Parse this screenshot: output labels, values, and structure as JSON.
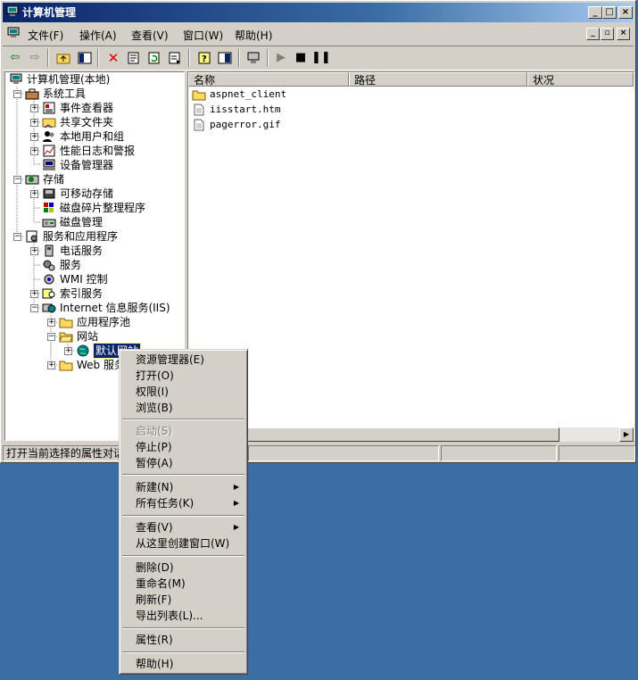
{
  "window": {
    "title": "计算机管理",
    "caption_buttons": [
      "_",
      "□",
      "×"
    ],
    "mdi_buttons": [
      "_",
      "▫",
      "×"
    ]
  },
  "menubar": {
    "items": [
      "文件(F)",
      "操作(A)",
      "查看(V)",
      "窗口(W)",
      "帮助(H)"
    ]
  },
  "tree": {
    "nodes": [
      {
        "label": "计算机管理(本地)"
      },
      {
        "label": "系统工具",
        "exp": "−"
      },
      {
        "label": "事件查看器",
        "exp": "+"
      },
      {
        "label": "共享文件夹",
        "exp": "+"
      },
      {
        "label": "本地用户和组",
        "exp": "+"
      },
      {
        "label": "性能日志和警报",
        "exp": "+"
      },
      {
        "label": "设备管理器"
      },
      {
        "label": "存储",
        "exp": "−"
      },
      {
        "label": "可移动存储",
        "exp": "+"
      },
      {
        "label": "磁盘碎片整理程序"
      },
      {
        "label": "磁盘管理"
      },
      {
        "label": "服务和应用程序",
        "exp": "−"
      },
      {
        "label": "电话服务",
        "exp": "+"
      },
      {
        "label": "服务"
      },
      {
        "label": "WMI 控制"
      },
      {
        "label": "索引服务",
        "exp": "+"
      },
      {
        "label": "Internet 信息服务(IIS)",
        "exp": "−"
      },
      {
        "label": "应用程序池",
        "exp": "+"
      },
      {
        "label": "网站",
        "exp": "−"
      },
      {
        "label": "默认网站",
        "exp": "+"
      },
      {
        "label": "Web 服务扩展",
        "exp": "+"
      }
    ]
  },
  "list": {
    "columns": [
      "名称",
      "路径",
      "状况"
    ],
    "rows": [
      {
        "name": "aspnet_client",
        "icon": "folder-icon"
      },
      {
        "name": "iisstart.htm",
        "icon": "document-icon"
      },
      {
        "name": "pagerror.gif",
        "icon": "document-icon"
      }
    ]
  },
  "status": {
    "text": "打开当前选择的属性对话框。"
  },
  "context_menu": {
    "items": [
      {
        "label": "资源管理器(E)"
      },
      {
        "label": "打开(O)"
      },
      {
        "label": "权限(I)"
      },
      {
        "label": "浏览(B)"
      },
      {
        "label": "启动(S)",
        "disabled": true
      },
      {
        "label": "停止(P)"
      },
      {
        "label": "暂停(A)"
      },
      {
        "label": "新建(N)",
        "submenu": true
      },
      {
        "label": "所有任务(K)",
        "submenu": true
      },
      {
        "label": "查看(V)",
        "submenu": true
      },
      {
        "label": "从这里创建窗口(W)"
      },
      {
        "label": "删除(D)"
      },
      {
        "label": "重命名(M)"
      },
      {
        "label": "刷新(F)"
      },
      {
        "label": "导出列表(L)..."
      },
      {
        "label": "属性(R)"
      },
      {
        "label": "帮助(H)"
      }
    ]
  },
  "colors": {
    "titlebar": "#0a246a",
    "desktop": "#3a6ea5",
    "selection": "#0a246a"
  }
}
